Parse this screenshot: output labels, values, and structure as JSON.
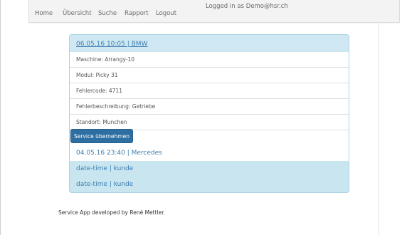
{
  "nav": {
    "home": "Home",
    "overview": "Übersicht",
    "search": "Suche",
    "report": "Rapport",
    "logout": "Logout",
    "status": "Logged in as Demo@hsr.ch"
  },
  "panel": {
    "title": "06.05.16 10:05 | BMW",
    "details": [
      "Maschine: Arrangy-10",
      "Modul: Picky 31",
      "Fehlercode: 4711",
      "Fehlerbeschreibung: Getriebe",
      "Standort: Munchen"
    ],
    "service_button": "Service übernehmen",
    "items": [
      "04.05.16 23:40 | Mercedes",
      "date-time | kunde",
      "date-time | kunde"
    ]
  },
  "footer": {
    "text": "Service App developed by René Mettler."
  }
}
